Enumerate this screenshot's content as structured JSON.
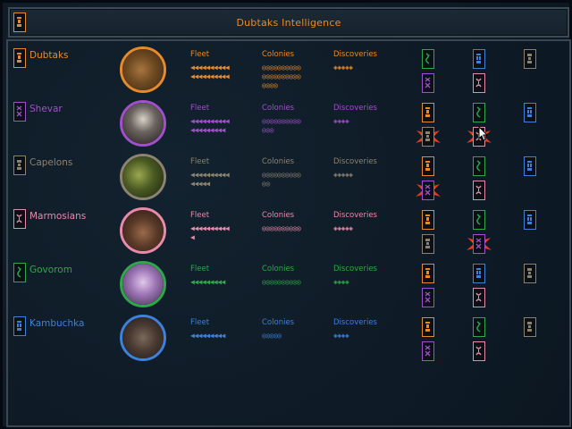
{
  "window": {
    "title": "Dubtaks Intelligence",
    "title_icon": "dubtaks-emblem-icon"
  },
  "labels": {
    "fleet": "Fleet",
    "colonies": "Colonies",
    "discoveries": "Discoveries"
  },
  "colors": {
    "dubtaks": "#e8892a",
    "shevar": "#a050c8",
    "capelons": "#8c8270",
    "marmosians": "#e88aaa",
    "govorom": "#2ea848",
    "kambuchka": "#3f80d8"
  },
  "races": [
    {
      "id": "dubtaks",
      "name": "Dubtaks",
      "color": "#e8892a",
      "fleet": "◀◀◀◀◀◀◀◀◀◀\n◀◀◀◀◀◀◀◀◀◀",
      "colonies": "◎◎◎◎◎◎◎◎◎◎\n◎◎◎◎◎◎◎◎◎◎\n◎◎◎◎",
      "discoveries": "◈◈◈◈◈",
      "portrait": "dubtaks-portrait"
    },
    {
      "id": "shevar",
      "name": "Shevar",
      "color": "#a050c8",
      "fleet": "◀◀◀◀◀◀◀◀◀◀\n◀◀◀◀◀◀◀◀◀",
      "colonies": "◎◎◎◎◎◎◎◎◎◎\n◎◎◎",
      "discoveries": "◈◈◈◈",
      "portrait": "shevar-portrait"
    },
    {
      "id": "capelons",
      "name": "Capelons",
      "color": "#8c8270",
      "fleet": "◀◀◀◀◀◀◀◀◀◀\n◀◀◀◀◀",
      "colonies": "◎◎◎◎◎◎◎◎◎◎\n◎◎",
      "discoveries": "◈◈◈◈◈",
      "portrait": "capelons-portrait"
    },
    {
      "id": "marmosians",
      "name": "Marmosians",
      "color": "#e88aaa",
      "fleet": "◀◀◀◀◀◀◀◀◀◀\n◀",
      "colonies": "◎◎◎◎◎◎◎◎◎◎",
      "discoveries": "◈◈◈◈◈",
      "portrait": "marmosians-portrait"
    },
    {
      "id": "govorom",
      "name": "Govorom",
      "color": "#2ea848",
      "fleet": "◀◀◀◀◀◀◀◀◀",
      "colonies": "◎◎◎◎◎◎◎◎◎◎",
      "discoveries": "◈◈◈◈",
      "portrait": "govorom-portrait"
    },
    {
      "id": "kambuchka",
      "name": "Kambuchka",
      "color": "#3f80d8",
      "fleet": "◀◀◀◀◀◀◀◀◀",
      "colonies": "◎◎◎◎◎",
      "discoveries": "◈◈◈◈",
      "portrait": "kambuchka-portrait"
    }
  ],
  "relations_grid": [
    [
      "govorom:shevar",
      "kambuchka:marmosians",
      "capelons"
    ],
    [
      "dubtaks:capelons*",
      "govorom:marmosians*",
      "kambuchka"
    ],
    [
      "dubtaks:shevar*",
      "govorom:marmosians",
      "kambuchka"
    ],
    [
      "dubtaks:capelons",
      "govorom:shevar*",
      "kambuchka"
    ],
    [
      "dubtaks:shevar",
      "kambuchka:marmosians",
      "capelons"
    ],
    [
      "dubtaks:shevar",
      "govorom:marmosians",
      "capelons"
    ]
  ]
}
